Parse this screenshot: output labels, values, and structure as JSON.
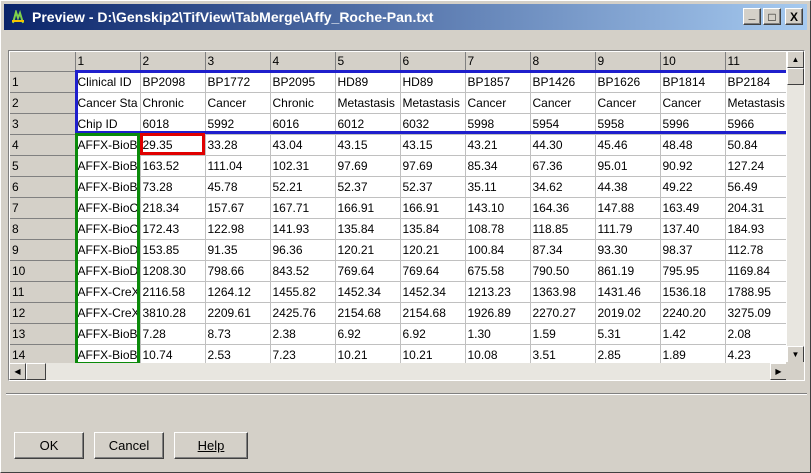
{
  "window": {
    "title": "Preview - D:\\Genskip2\\TifView\\TabMerge\\Affy_Roche-Pan.txt",
    "buttons": [
      "_",
      "□",
      "X"
    ]
  },
  "grid": {
    "column_headers": [
      "",
      "1",
      "2",
      "3",
      "4",
      "5",
      "6",
      "7",
      "8",
      "9",
      "10",
      "11"
    ],
    "rows": [
      {
        "n": "1",
        "cells": [
          "Clinical ID",
          "BP2098",
          "BP1772",
          "BP2095",
          "HD89",
          "HD89",
          "BP1857",
          "BP1426",
          "BP1626",
          "BP1814",
          "BP2184"
        ]
      },
      {
        "n": "2",
        "cells": [
          "Cancer Sta",
          "Chronic",
          "Cancer",
          "Chronic",
          "Metastasis",
          "Metastasis",
          "Cancer",
          "Cancer",
          "Cancer",
          "Cancer",
          "Metastasis"
        ]
      },
      {
        "n": "3",
        "cells": [
          "Chip ID",
          "6018",
          "5992",
          "6016",
          "6012",
          "6032",
          "5998",
          "5954",
          "5958",
          "5996",
          "5966"
        ]
      },
      {
        "n": "4",
        "cells": [
          "AFFX-BioB",
          "29.35",
          "33.28",
          "43.04",
          "43.15",
          "43.15",
          "43.21",
          "44.30",
          "45.46",
          "48.48",
          "50.84"
        ]
      },
      {
        "n": "5",
        "cells": [
          "AFFX-BioB",
          "163.52",
          "111.04",
          "102.31",
          "97.69",
          "97.69",
          "85.34",
          "67.36",
          "95.01",
          "90.92",
          "127.24"
        ]
      },
      {
        "n": "6",
        "cells": [
          "AFFX-BioB",
          "73.28",
          "45.78",
          "52.21",
          "52.37",
          "52.37",
          "35.11",
          "34.62",
          "44.38",
          "49.22",
          "56.49"
        ]
      },
      {
        "n": "7",
        "cells": [
          "AFFX-BioC",
          "218.34",
          "157.67",
          "167.71",
          "166.91",
          "166.91",
          "143.10",
          "164.36",
          "147.88",
          "163.49",
          "204.31"
        ]
      },
      {
        "n": "8",
        "cells": [
          "AFFX-BioC",
          "172.43",
          "122.98",
          "141.93",
          "135.84",
          "135.84",
          "108.78",
          "118.85",
          "111.79",
          "137.40",
          "184.93"
        ]
      },
      {
        "n": "9",
        "cells": [
          "AFFX-BioD",
          "153.85",
          "91.35",
          "96.36",
          "120.21",
          "120.21",
          "100.84",
          "87.34",
          "93.30",
          "98.37",
          "112.78"
        ]
      },
      {
        "n": "10",
        "cells": [
          "AFFX-BioD",
          "1208.30",
          "798.66",
          "843.52",
          "769.64",
          "769.64",
          "675.58",
          "790.50",
          "861.19",
          "795.95",
          "1169.84"
        ]
      },
      {
        "n": "11",
        "cells": [
          "AFFX-CreX",
          "2116.58",
          "1264.12",
          "1455.82",
          "1452.34",
          "1452.34",
          "1213.23",
          "1363.98",
          "1431.46",
          "1536.18",
          "1788.95"
        ]
      },
      {
        "n": "12",
        "cells": [
          "AFFX-CreX",
          "3810.28",
          "2209.61",
          "2425.76",
          "2154.68",
          "2154.68",
          "1926.89",
          "2270.27",
          "2019.02",
          "2240.20",
          "3275.09"
        ]
      },
      {
        "n": "13",
        "cells": [
          "AFFX-BioB",
          "7.28",
          "8.73",
          "2.38",
          "6.92",
          "6.92",
          "1.30",
          "1.59",
          "5.31",
          "1.42",
          "2.08"
        ]
      },
      {
        "n": "14",
        "cells": [
          "AFFX-BioB",
          "10.74",
          "2.53",
          "7.23",
          "10.21",
          "10.21",
          "10.08",
          "3.51",
          "2.85",
          "1.89",
          "4.23"
        ]
      }
    ]
  },
  "highlights": {
    "blue": "#1f1fcc",
    "green": "#0a8a0a",
    "red": "#e00000"
  },
  "buttons": {
    "ok": "OK",
    "cancel": "Cancel",
    "help": "Help"
  }
}
